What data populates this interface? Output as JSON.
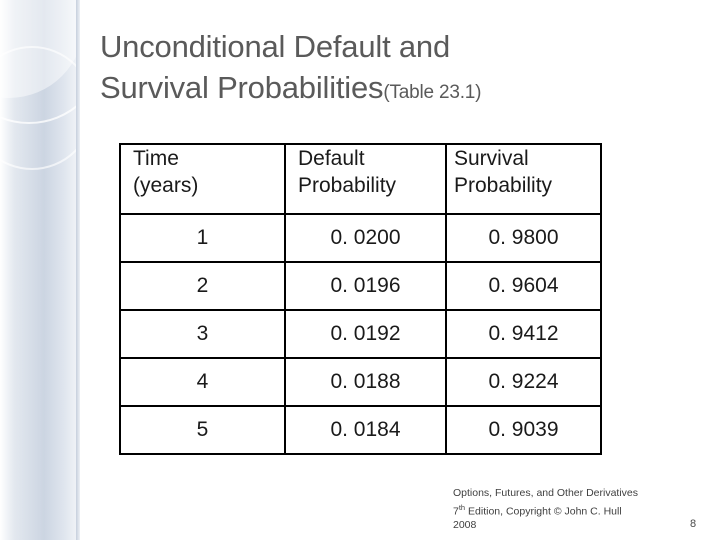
{
  "slide": {
    "title_line1": "Unconditional Default and",
    "title_line2": "Survival Probabilities",
    "title_suffix": "(Table 23.1)"
  },
  "table": {
    "headers": [
      {
        "line1": "Time",
        "line2": "(years)"
      },
      {
        "line1": "Default",
        "line2": "Probability"
      },
      {
        "line1": "Survival",
        "line2": "Probability"
      }
    ],
    "rows": [
      {
        "time": "1",
        "default_probability": "0. 0200",
        "survival_probability": "0. 9800"
      },
      {
        "time": "2",
        "default_probability": "0. 0196",
        "survival_probability": "0. 9604"
      },
      {
        "time": "3",
        "default_probability": "0. 0192",
        "survival_probability": "0. 9412"
      },
      {
        "time": "4",
        "default_probability": "0. 0188",
        "survival_probability": "0. 9224"
      },
      {
        "time": "5",
        "default_probability": "0. 0184",
        "survival_probability": "0. 9039"
      }
    ]
  },
  "footer": {
    "line1": "Options, Futures, and Other Derivatives",
    "line2_prefix": "7",
    "line2_sup": "th",
    "line2_rest": " Edition, Copyright © John C. Hull",
    "line3": "2008",
    "page_number": "8"
  }
}
